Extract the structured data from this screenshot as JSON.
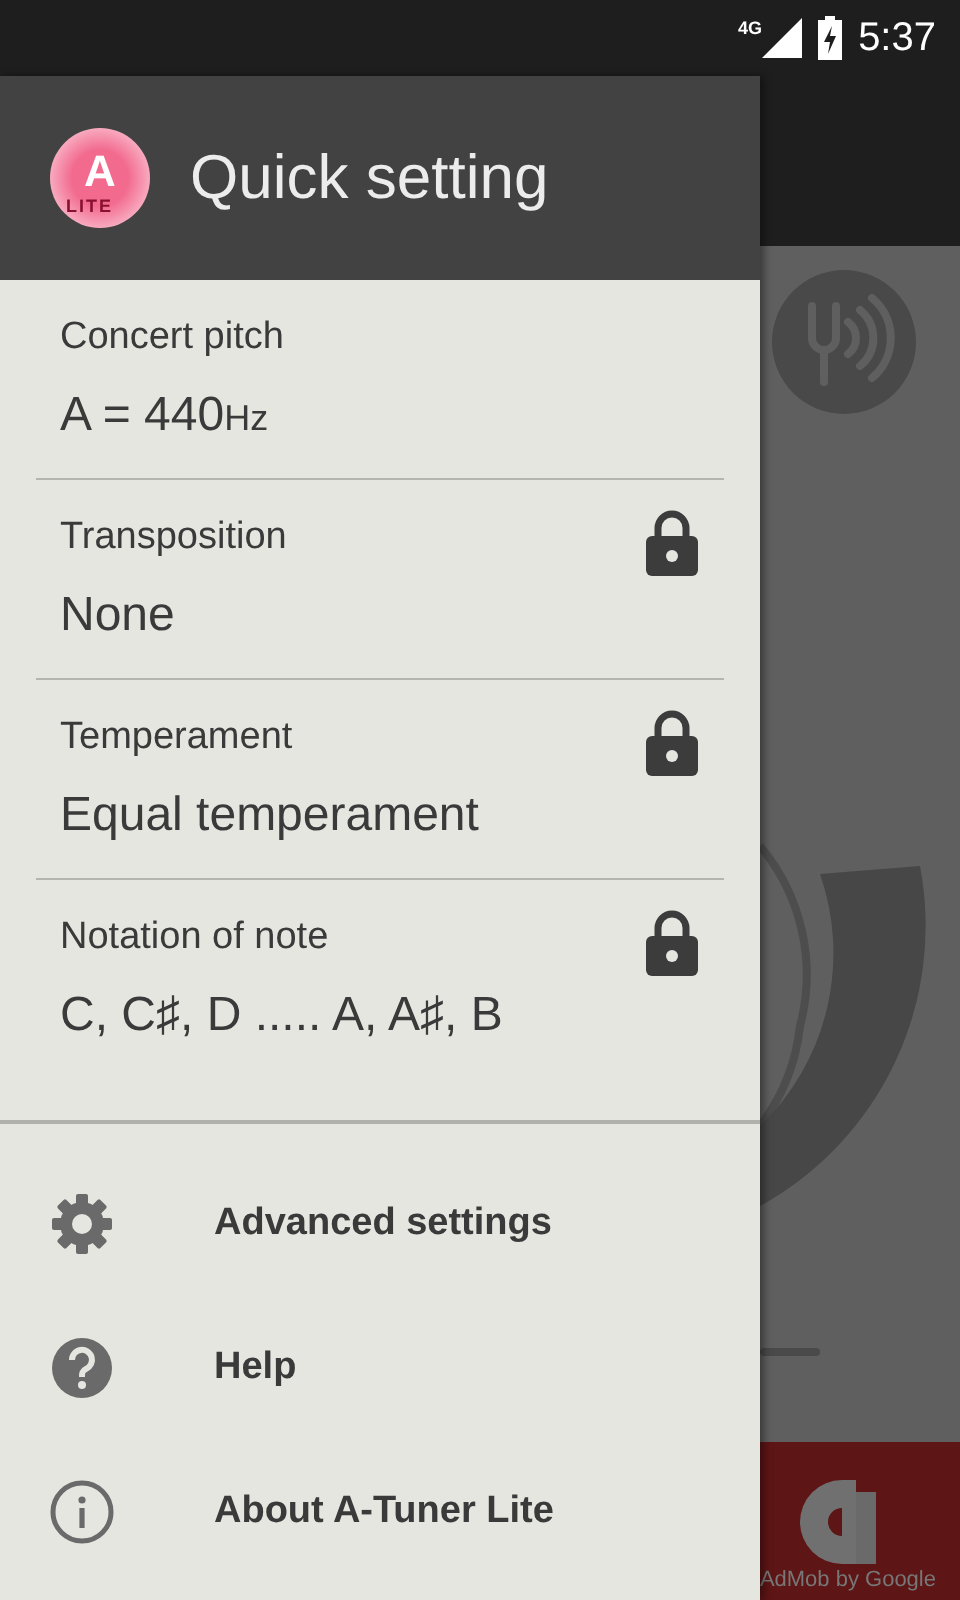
{
  "status_bar": {
    "network": "4G",
    "time": "5:37"
  },
  "drawer": {
    "logo": {
      "letter": "A",
      "badge": "LITE"
    },
    "title": "Quick setting",
    "settings": [
      {
        "label": "Concert pitch",
        "value": "A = 440",
        "unit": "Hz",
        "locked": false
      },
      {
        "label": "Transposition",
        "value": "None",
        "locked": true
      },
      {
        "label": "Temperament",
        "value": "Equal temperament",
        "locked": true
      },
      {
        "label": "Notation of note",
        "value": "C, C♯, D ..... A, A♯, B",
        "locked": true
      }
    ],
    "menu": [
      {
        "kind": "settings",
        "label": "Advanced settings"
      },
      {
        "kind": "help",
        "label": "Help"
      },
      {
        "kind": "info",
        "label": "About A-Tuner Lite"
      }
    ]
  },
  "ad_banner": {
    "text": "AdMob by Google"
  }
}
